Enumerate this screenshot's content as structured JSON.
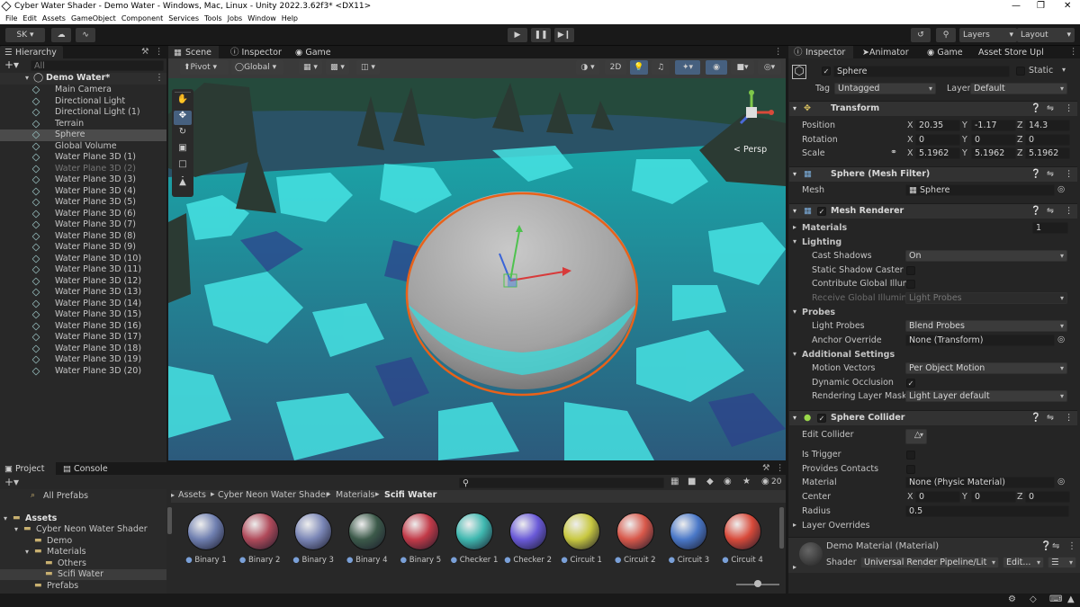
{
  "window": {
    "title": "Cyber Water Shader - Demo Water - Windows, Mac, Linux - Unity 2022.3.62f3* <DX11>"
  },
  "menu": [
    "File",
    "Edit",
    "Assets",
    "GameObject",
    "Component",
    "Services",
    "Tools",
    "Jobs",
    "Window",
    "Help"
  ],
  "toolbar": {
    "account": "SK",
    "layers": "Layers",
    "layout": "Layout"
  },
  "hierarchy": {
    "tab": "Hierarchy",
    "search_placeholder": "All",
    "scene": "Demo Water*",
    "items": [
      {
        "name": "Main Camera",
        "dim": false,
        "selected": false
      },
      {
        "name": "Directional Light",
        "dim": false,
        "selected": false
      },
      {
        "name": "Directional Light (1)",
        "dim": false,
        "selected": false
      },
      {
        "name": "Terrain",
        "dim": false,
        "selected": false
      },
      {
        "name": "Sphere",
        "dim": false,
        "selected": true
      },
      {
        "name": "Global Volume",
        "dim": false,
        "selected": false
      },
      {
        "name": "Water Plane 3D (1)",
        "dim": false,
        "selected": false
      },
      {
        "name": "Water Plane 3D (2)",
        "dim": true,
        "selected": false
      },
      {
        "name": "Water Plane 3D (3)",
        "dim": false,
        "selected": false
      },
      {
        "name": "Water Plane 3D (4)",
        "dim": false,
        "selected": false
      },
      {
        "name": "Water Plane 3D (5)",
        "dim": false,
        "selected": false
      },
      {
        "name": "Water Plane 3D (6)",
        "dim": false,
        "selected": false
      },
      {
        "name": "Water Plane 3D (7)",
        "dim": false,
        "selected": false
      },
      {
        "name": "Water Plane 3D (8)",
        "dim": false,
        "selected": false
      },
      {
        "name": "Water Plane 3D (9)",
        "dim": false,
        "selected": false
      },
      {
        "name": "Water Plane 3D (10)",
        "dim": false,
        "selected": false
      },
      {
        "name": "Water Plane 3D (11)",
        "dim": false,
        "selected": false
      },
      {
        "name": "Water Plane 3D (12)",
        "dim": false,
        "selected": false
      },
      {
        "name": "Water Plane 3D (13)",
        "dim": false,
        "selected": false
      },
      {
        "name": "Water Plane 3D (14)",
        "dim": false,
        "selected": false
      },
      {
        "name": "Water Plane 3D (15)",
        "dim": false,
        "selected": false
      },
      {
        "name": "Water Plane 3D (16)",
        "dim": false,
        "selected": false
      },
      {
        "name": "Water Plane 3D (17)",
        "dim": false,
        "selected": false
      },
      {
        "name": "Water Plane 3D (18)",
        "dim": false,
        "selected": false
      },
      {
        "name": "Water Plane 3D (19)",
        "dim": false,
        "selected": false
      },
      {
        "name": "Water Plane 3D (20)",
        "dim": false,
        "selected": false
      }
    ]
  },
  "scene_view": {
    "tabs": [
      "Scene",
      "Inspector",
      "Game"
    ],
    "pivot": "Pivot",
    "space": "Global",
    "mode_2d": "2D",
    "persp": "< Persp"
  },
  "inspector": {
    "tabs": [
      "Inspector",
      "Animator",
      "Game",
      "Asset Store Upl"
    ],
    "object_name": "Sphere",
    "static_label": "Static",
    "tag_label": "Tag",
    "tag": "Untagged",
    "layer_label": "Layer",
    "layer": "Default",
    "transform": {
      "title": "Transform",
      "position_label": "Position",
      "rotation_label": "Rotation",
      "scale_label": "Scale",
      "position": {
        "x": "20.35",
        "y": "-1.17",
        "z": "14.3"
      },
      "rotation": {
        "x": "0",
        "y": "0",
        "z": "0"
      },
      "scale": {
        "x": "5.1962",
        "y": "5.1962",
        "z": "5.1962"
      },
      "axis": {
        "x": "X",
        "y": "Y",
        "z": "Z"
      }
    },
    "mesh_filter": {
      "title": "Sphere (Mesh Filter)",
      "mesh_label": "Mesh",
      "mesh": "Sphere"
    },
    "mesh_renderer": {
      "title": "Mesh Renderer",
      "materials_label": "Materials",
      "materials_count": "1",
      "lighting": "Lighting",
      "cast_shadows_label": "Cast Shadows",
      "cast_shadows": "On",
      "static_shadow_caster": "Static Shadow Caster",
      "contribute_gi": "Contribute Global Illum",
      "receive_gi_label": "Receive Global Illumina",
      "receive_gi": "Light Probes",
      "probes": "Probes",
      "light_probes_label": "Light Probes",
      "light_probes": "Blend Probes",
      "anchor_override_label": "Anchor Override",
      "anchor_override": "None (Transform)",
      "additional_settings": "Additional Settings",
      "motion_vectors_label": "Motion Vectors",
      "motion_vectors": "Per Object Motion",
      "dynamic_occlusion": "Dynamic Occlusion",
      "rendering_layer_mask_label": "Rendering Layer Mask",
      "rendering_layer_mask": "Light Layer default"
    },
    "sphere_collider": {
      "title": "Sphere Collider",
      "edit_collider": "Edit Collider",
      "is_trigger": "Is Trigger",
      "provides_contacts": "Provides Contacts",
      "material_label": "Material",
      "material": "None (Physic Material)",
      "center_label": "Center",
      "center": {
        "x": "0",
        "y": "0",
        "z": "0"
      },
      "radius_label": "Radius",
      "radius": "0.5",
      "layer_overrides": "Layer Overrides"
    },
    "material": {
      "title": "Demo Material (Material)",
      "shader_label": "Shader",
      "shader": "Universal Render Pipeline/Lit",
      "edit": "Edit..."
    }
  },
  "project": {
    "tabs": [
      "Project",
      "Console"
    ],
    "breadcrumb": [
      "Assets",
      "Cyber Neon Water Shader",
      "Materials",
      "Scifi Water"
    ],
    "count": "20",
    "tree": [
      {
        "name": "All Prefabs",
        "indent": 0
      },
      {
        "name": "Assets",
        "indent": 0
      },
      {
        "name": "Cyber Neon Water Shader",
        "indent": 1
      },
      {
        "name": "Demo",
        "indent": 2
      },
      {
        "name": "Materials",
        "indent": 2
      },
      {
        "name": "Others",
        "indent": 3
      },
      {
        "name": "Scifi Water",
        "indent": 3
      },
      {
        "name": "Prefabs",
        "indent": 2
      }
    ],
    "assets": [
      {
        "name": "Binary 1",
        "color": "#6f7fb0"
      },
      {
        "name": "Binary 2",
        "color": "#b04a5a"
      },
      {
        "name": "Binary 3",
        "color": "#7a86b6"
      },
      {
        "name": "Binary 4",
        "color": "#3c5a4a"
      },
      {
        "name": "Binary 5",
        "color": "#c23a48"
      },
      {
        "name": "Checker 1",
        "color": "#3fb8b0"
      },
      {
        "name": "Checker 2",
        "color": "#6a5ad8"
      },
      {
        "name": "Circuit 1",
        "color": "#c8c840"
      },
      {
        "name": "Circuit 2",
        "color": "#d8584a"
      },
      {
        "name": "Circuit 3",
        "color": "#4a78c8"
      },
      {
        "name": "Circuit 4",
        "color": "#d84a3a"
      }
    ]
  }
}
